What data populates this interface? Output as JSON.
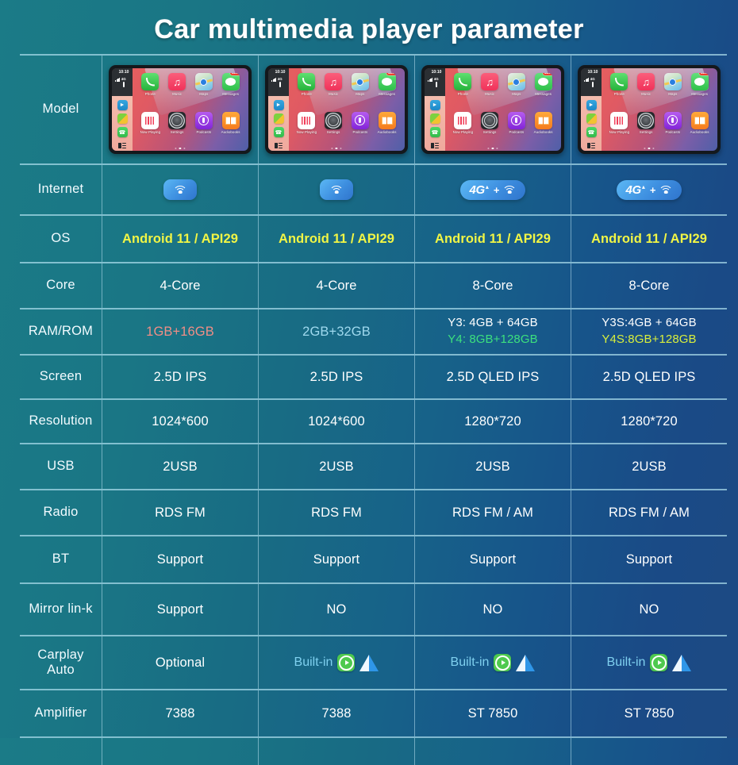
{
  "header": {
    "title": "Car multimedia player parameter"
  },
  "colors": {
    "bg_left": "#1b7b87",
    "bg_right": "#1d4a83",
    "divider": "#aadceb",
    "os_yellow": "#f1f545",
    "ram_pink": "#f08e86",
    "ram_cyan": "#9fd9ee",
    "ram_green": "#3ce07e",
    "ram_lime": "#d9ef3c",
    "built_in_blue": "#7fd0ef",
    "carplay_green": "#4ec94e",
    "android_auto_blue": "#2f96e8"
  },
  "device_mock": {
    "status_time": "10:10",
    "status_network": "4G",
    "sidebar_icons": [
      "telegram-icon",
      "wechat-icon",
      "phone-icon",
      "app-list-icon"
    ],
    "apps": [
      {
        "label": "Phone",
        "icon": "phone-icon",
        "badge": ""
      },
      {
        "label": "Music",
        "icon": "music-icon",
        "badge": ""
      },
      {
        "label": "Maps",
        "icon": "maps-icon",
        "badge": ""
      },
      {
        "label": "Messages",
        "icon": "messages-icon",
        "badge": "4159"
      },
      {
        "label": "Now Playing",
        "icon": "now-playing-icon",
        "badge": ""
      },
      {
        "label": "Settings",
        "icon": "settings-icon",
        "badge": ""
      },
      {
        "label": "Podcasts",
        "icon": "podcasts-icon",
        "badge": ""
      },
      {
        "label": "Audiobooks",
        "icon": "audiobooks-icon",
        "badge": ""
      }
    ],
    "page_dots": 3,
    "active_dot": 1
  },
  "rows": {
    "model": {
      "label": "Model"
    },
    "internet": {
      "label": "Internet",
      "values": [
        {
          "type": "wifi",
          "wifi": true,
          "four_g": "",
          "plus": ""
        },
        {
          "type": "wifi",
          "wifi": true,
          "four_g": "",
          "plus": ""
        },
        {
          "type": "four_g",
          "wifi": true,
          "four_g": "4G",
          "plus": "+"
        },
        {
          "type": "four_g",
          "wifi": true,
          "four_g": "4G",
          "plus": "+"
        }
      ]
    },
    "os": {
      "label": "OS",
      "values": [
        "Android 11 / API29",
        "Android 11 / API29",
        "Android 11 / API29",
        "Android 11 / API29"
      ]
    },
    "core": {
      "label": "Core",
      "values": [
        "4-Core",
        "4-Core",
        "8-Core",
        "8-Core"
      ]
    },
    "ram": {
      "label": "RAM/ROM",
      "values": [
        {
          "line1": "1GB+16GB",
          "line1_color": "pink",
          "line2": "",
          "line2_color": ""
        },
        {
          "line1": "2GB+32GB",
          "line1_color": "cyan",
          "line2": "",
          "line2_color": ""
        },
        {
          "line1": "Y3: 4GB + 64GB",
          "line1_color": "white",
          "line2": "Y4: 8GB+128GB",
          "line2_color": "green"
        },
        {
          "line1": "Y3S:4GB + 64GB",
          "line1_color": "white",
          "line2": "Y4S:8GB+128GB",
          "line2_color": "lime"
        }
      ]
    },
    "screen": {
      "label": "Screen",
      "values": [
        "2.5D  IPS",
        "2.5D  IPS",
        "2.5D QLED IPS",
        "2.5D QLED IPS"
      ]
    },
    "resolution": {
      "label": "Resolution",
      "values": [
        "1024*600",
        "1024*600",
        "1280*720",
        "1280*720"
      ]
    },
    "usb": {
      "label": "USB",
      "values": [
        "2USB",
        "2USB",
        "2USB",
        "2USB"
      ]
    },
    "radio": {
      "label": "Radio",
      "values": [
        "RDS FM",
        "RDS FM",
        "RDS FM / AM",
        "RDS FM / AM"
      ]
    },
    "bt": {
      "label": "BT",
      "values": [
        "Support",
        "Support",
        "Support",
        "Support"
      ]
    },
    "mirror": {
      "label": "Mirror lin-k",
      "values": [
        "Support",
        "NO",
        "NO",
        "NO"
      ]
    },
    "carplay": {
      "label_line1": "Carplay",
      "label_line2": "Auto",
      "values": [
        {
          "text": "Optional",
          "icons": false
        },
        {
          "text": "Built-in",
          "icons": true
        },
        {
          "text": "Built-in",
          "icons": true
        },
        {
          "text": "Built-in",
          "icons": true
        }
      ]
    },
    "amplifier": {
      "label": "Amplifier",
      "values": [
        "7388",
        "7388",
        "ST 7850",
        "ST 7850"
      ]
    }
  }
}
